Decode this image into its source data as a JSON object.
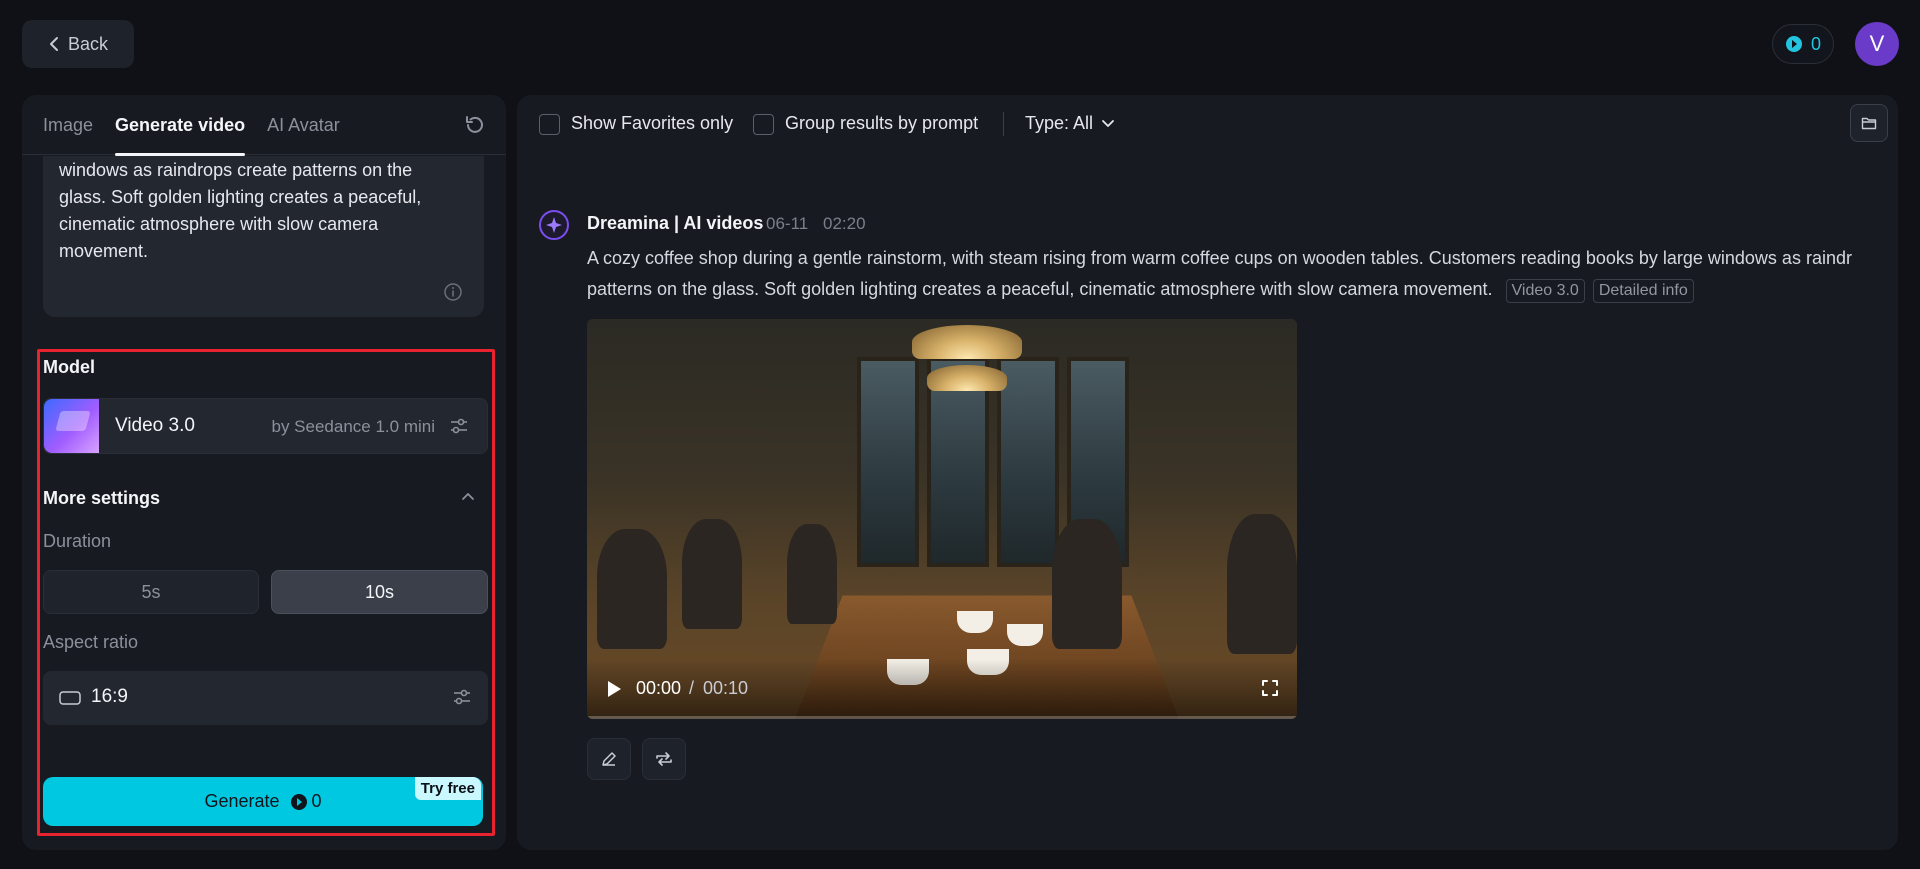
{
  "header": {
    "back_label": "Back",
    "credits": "0",
    "avatar_initial": "V"
  },
  "left_panel": {
    "tabs": [
      {
        "label": "Image",
        "active": false
      },
      {
        "label": "Generate video",
        "active": true
      },
      {
        "label": "AI Avatar",
        "active": false
      }
    ],
    "prompt_text": "windows as raindrops create patterns on the glass. Soft golden lighting creates a peaceful, cinematic atmosphere with slow camera movement.",
    "model": {
      "section_label": "Model",
      "name": "Video 3.0",
      "by": "by Seedance 1.0 mini"
    },
    "more_settings_label": "More settings",
    "duration": {
      "label": "Duration",
      "options": [
        "5s",
        "10s"
      ],
      "selected": "10s"
    },
    "aspect_ratio": {
      "label": "Aspect ratio",
      "value": "16:9"
    },
    "generate": {
      "label": "Generate",
      "cost": "0",
      "badge": "Try free"
    }
  },
  "right_panel": {
    "filters": {
      "favorites_label": "Show Favorites only",
      "group_label": "Group results by prompt",
      "type_label": "Type: All"
    },
    "post": {
      "author": "Dreamina | AI videos",
      "date": "06-11",
      "time": "02:20",
      "prompt": "A cozy coffee shop during a gentle rainstorm, with steam rising from warm coffee cups on wooden tables. Customers reading books by large windows as raindr patterns on the glass. Soft golden lighting creates a peaceful, cinematic atmosphere with slow camera movement.",
      "tags": [
        "Video 3.0",
        "Detailed info"
      ],
      "video": {
        "current_time": "00:00",
        "separator": "/",
        "total_time": "00:10",
        "progress": 0
      }
    }
  },
  "colors": {
    "accent": "#00c8e0",
    "highlight_border": "#e8232f",
    "avatar_bg": "#6a3bc9"
  }
}
